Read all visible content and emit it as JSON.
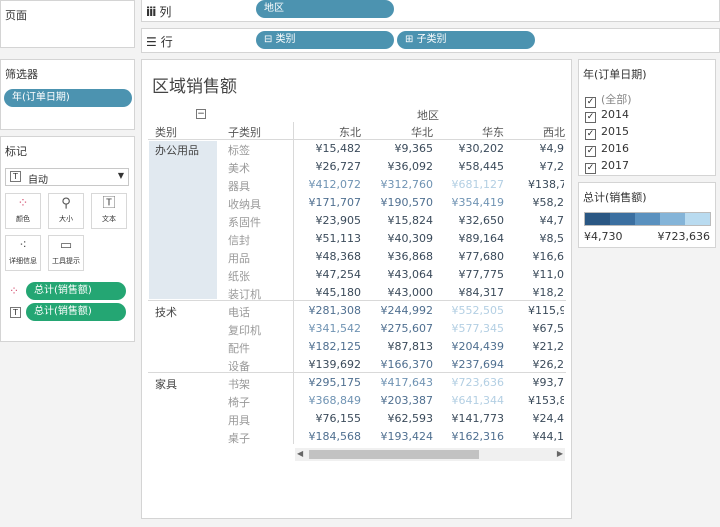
{
  "left": {
    "pages_title": "页面",
    "filters_title": "筛选器",
    "filter_pill": "年(订单日期)",
    "marks_title": "标记",
    "mark_type": "自动",
    "mark_buttons": [
      {
        "label": "颜色",
        "icon": "dots-icon"
      },
      {
        "label": "大小",
        "icon": "size-icon"
      },
      {
        "label": "文本",
        "icon": "text-icon"
      },
      {
        "label": "详细信息",
        "icon": "detail-icon"
      },
      {
        "label": "工具提示",
        "icon": "tooltip-icon"
      }
    ],
    "mark_pills": [
      "总计(销售额)",
      "总计(销售额)"
    ]
  },
  "shelves": {
    "columns_label": "列",
    "rows_label": "行",
    "columns_pills": [
      "地区"
    ],
    "rows_pills": [
      "⊟ 类别",
      "⊞ 子类别"
    ]
  },
  "view": {
    "title": "区域销售额",
    "collapse_glyph": "−",
    "region_header": "地区",
    "category_header": "类别",
    "subcategory_header": "子类别",
    "regions": [
      "东北",
      "华北",
      "华东",
      "西北"
    ],
    "groups": [
      {
        "category": "办公用品",
        "rows": [
          {
            "sub": "标签",
            "values": [
              "¥15,482",
              "¥9,365",
              "¥30,202",
              "¥4,9"
            ]
          },
          {
            "sub": "美术",
            "values": [
              "¥26,727",
              "¥36,092",
              "¥58,445",
              "¥7,2"
            ]
          },
          {
            "sub": "器具",
            "values": [
              "¥412,072",
              "¥312,760",
              "¥681,127",
              "¥138,7"
            ]
          },
          {
            "sub": "收纳具",
            "values": [
              "¥171,707",
              "¥190,570",
              "¥354,419",
              "¥58,2"
            ]
          },
          {
            "sub": "系固件",
            "values": [
              "¥23,905",
              "¥15,824",
              "¥32,650",
              "¥4,7"
            ]
          },
          {
            "sub": "信封",
            "values": [
              "¥51,113",
              "¥40,309",
              "¥89,164",
              "¥8,5"
            ]
          },
          {
            "sub": "用品",
            "values": [
              "¥48,368",
              "¥36,868",
              "¥77,680",
              "¥16,6"
            ]
          },
          {
            "sub": "纸张",
            "values": [
              "¥47,254",
              "¥43,064",
              "¥77,775",
              "¥11,0"
            ]
          },
          {
            "sub": "装订机",
            "values": [
              "¥45,180",
              "¥43,000",
              "¥84,317",
              "¥18,2"
            ]
          }
        ]
      },
      {
        "category": "技术",
        "rows": [
          {
            "sub": "电话",
            "values": [
              "¥281,308",
              "¥244,992",
              "¥552,505",
              "¥115,9"
            ]
          },
          {
            "sub": "复印机",
            "values": [
              "¥341,542",
              "¥275,607",
              "¥577,345",
              "¥67,5"
            ]
          },
          {
            "sub": "配件",
            "values": [
              "¥182,125",
              "¥87,813",
              "¥204,439",
              "¥21,2"
            ]
          },
          {
            "sub": "设备",
            "values": [
              "¥139,692",
              "¥166,370",
              "¥237,694",
              "¥26,2"
            ]
          }
        ]
      },
      {
        "category": "家具",
        "rows": [
          {
            "sub": "书架",
            "values": [
              "¥295,175",
              "¥417,643",
              "¥723,636",
              "¥93,7"
            ]
          },
          {
            "sub": "椅子",
            "values": [
              "¥368,849",
              "¥203,387",
              "¥641,344",
              "¥153,8"
            ]
          },
          {
            "sub": "用具",
            "values": [
              "¥76,155",
              "¥62,593",
              "¥141,773",
              "¥24,4"
            ]
          },
          {
            "sub": "桌子",
            "values": [
              "¥184,568",
              "¥193,424",
              "¥162,316",
              "¥44,1"
            ]
          }
        ]
      }
    ]
  },
  "year_filter": {
    "title": "年(订单日期)",
    "options": [
      "(全部)",
      "2014",
      "2015",
      "2016",
      "2017"
    ]
  },
  "legend": {
    "title": "总计(销售额)",
    "min_label": "¥4,730",
    "max_label": "¥723,636",
    "colors": [
      "#2a5783",
      "#3b6fa0",
      "#5a91bf",
      "#84b4d8",
      "#b9dbf0"
    ]
  }
}
